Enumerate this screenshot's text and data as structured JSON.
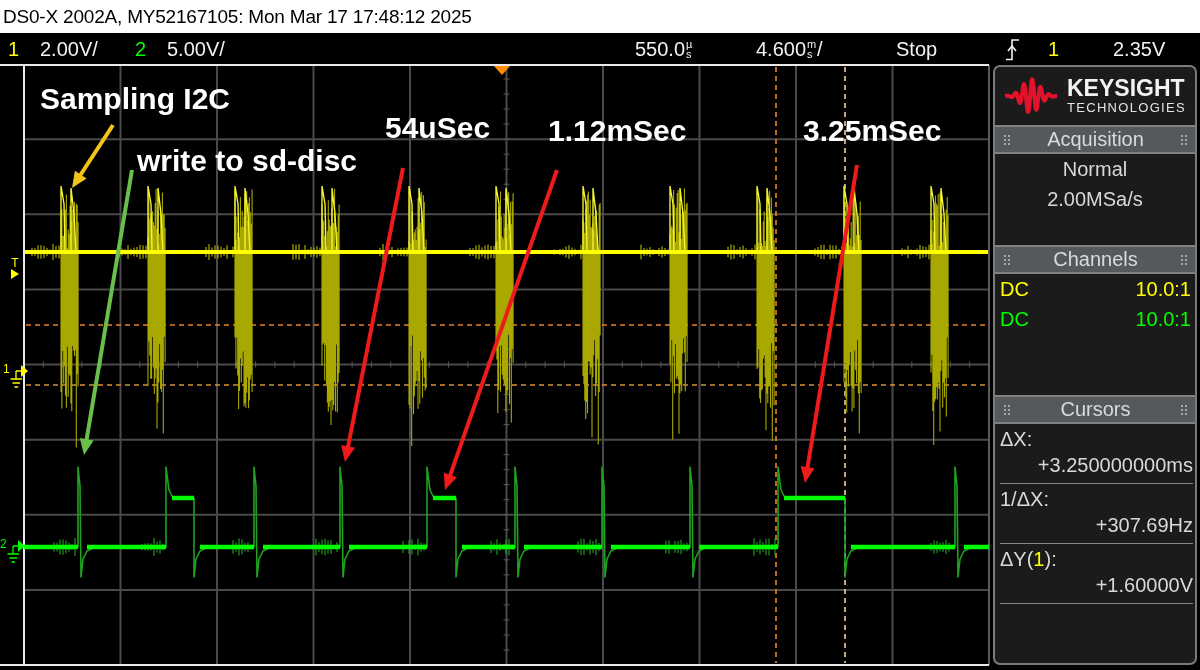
{
  "title_bar": {
    "text": "DS0-X 2002A, MY52167105: Mon Mar 17 17:48:12 2025"
  },
  "status_bar": {
    "channels": [
      {
        "number": "1",
        "scale": "2.00V/",
        "color": "#ffff00"
      },
      {
        "number": "2",
        "scale": "5.00V/",
        "color": "#00ff00"
      }
    ],
    "delay": {
      "value": "550.0",
      "unit": "µs"
    },
    "timebase": {
      "value": "4.600",
      "unit": "ms",
      "suffix": "/"
    },
    "run_state": "Stop",
    "trigger": {
      "source": "1",
      "color": "#ffff00",
      "level": "2.35V"
    }
  },
  "display": {
    "markers": [
      {
        "kind": "trigger_level",
        "label": "T",
        "color": "#ffff00"
      },
      {
        "kind": "ground",
        "label": "1",
        "color": "#ffff00"
      },
      {
        "kind": "ground",
        "label": "2",
        "color": "#00ff00"
      }
    ],
    "annotations": [
      "Sampling I2C",
      "write to sd-disc",
      "54uSec",
      "1.12mSec",
      "3.25mSec"
    ]
  },
  "side_panel": {
    "logo": {
      "name": "KEYSIGHT",
      "subtitle": "TECHNOLOGIES"
    },
    "sections": [
      {
        "kind": "acquisition",
        "title": "Acquisition",
        "lines": [
          "Normal",
          "2.00MSa/s"
        ]
      },
      {
        "kind": "channels",
        "title": "Channels",
        "rows": [
          {
            "coupling": "DC",
            "probe": "10.0:1",
            "color": "#ffff00"
          },
          {
            "coupling": "DC",
            "probe": "10.0:1",
            "color": "#00ff00"
          }
        ]
      },
      {
        "kind": "cursors",
        "title": "Cursors",
        "readouts": [
          {
            "label": "ΔX:",
            "value": "+3.250000000ms"
          },
          {
            "label": "1/ΔX:",
            "value": "+307.69Hz"
          },
          {
            "label": "ΔY(",
            "source": {
              "text": "1",
              "color": "#ffff00"
            },
            "label_end": "):",
            "value": "+1.60000V"
          }
        ]
      }
    ]
  }
}
